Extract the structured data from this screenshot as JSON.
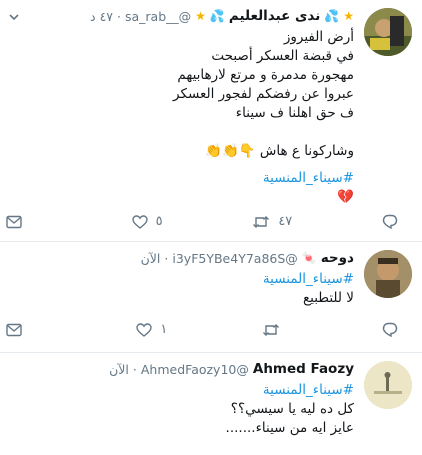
{
  "tweets": [
    {
      "display_name": "ندى عبدالعليم",
      "handle": "@__sa_rab",
      "time": "٤٧ د",
      "lines": [
        "أرض الفيروز",
        "في قبضة العسكر أصبحت",
        "مهجورة مدمرة و مرتع لارهابيهم",
        "عبروا عن رفضكم لفجور العسكر",
        "ف حق اهلنا ف سيناء"
      ],
      "line_after_gap": "وشاركونا ع هاش 👇👏👏",
      "hashtag": "#سيناء_المنسية",
      "heart_emoji": "💔",
      "retweets": "٤٧",
      "likes": "٥"
    },
    {
      "display_name": "دوحه",
      "name_emoji": "🍬",
      "handle": "@i3yF5YBe4Y7a86S",
      "time": "الآن",
      "hashtag": "#سيناء_المنسية",
      "text": "لا للتطبيع",
      "retweets": "",
      "likes": "١"
    },
    {
      "display_name": "Ahmed Faozy",
      "handle": "@AhmedFaozy10",
      "time": "الآن",
      "hashtag": "#سيناء_المنسية",
      "lines": [
        "كل ده ليه يا سيسي؟؟",
        "عايز ايه من سيناء......."
      ]
    }
  ],
  "colors": {
    "accent": "#1b95e0",
    "muted": "#657786",
    "border": "#e6ecf0",
    "heart_red": "#e0245e"
  }
}
